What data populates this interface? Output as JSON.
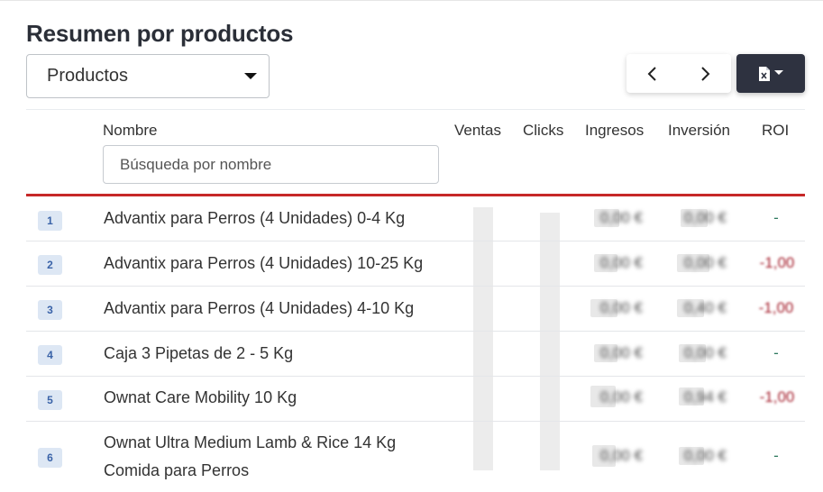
{
  "header": {
    "title": "Resumen por productos",
    "selector_value": "Productos"
  },
  "table": {
    "columns": {
      "name": "Nombre",
      "sales": "Ventas",
      "clicks": "Clicks",
      "revenue": "Ingresos",
      "investment": "Inversión",
      "roi": "ROI"
    },
    "search_placeholder": "Búsqueda por nombre",
    "rows": [
      {
        "index": "1",
        "name": "Advantix para Perros (4 Unidades) 0-4 Kg",
        "revenue": "0,00 €",
        "investment": "0,00 €",
        "roi": "-"
      },
      {
        "index": "2",
        "name": "Advantix para Perros (4 Unidades) 10-25 Kg",
        "revenue": "0,00 €",
        "investment": "0,00 €",
        "roi": "-1,00"
      },
      {
        "index": "3",
        "name": "Advantix para Perros (4 Unidades) 4-10 Kg",
        "revenue": "0,00 €",
        "investment": "0,40 €",
        "roi": "-1,00"
      },
      {
        "index": "4",
        "name": "Caja 3 Pipetas de 2 - 5 Kg",
        "revenue": "0,00 €",
        "investment": "0,00 €",
        "roi": "-"
      },
      {
        "index": "5",
        "name": "Ownat Care Mobility 10 Kg",
        "revenue": "0,00 €",
        "investment": "0,94 €",
        "roi": "-1,00"
      },
      {
        "index": "6",
        "name_line1": "Ownat Ultra Medium Lamb & Rice 14 Kg",
        "name_line2": "Comida para Perros",
        "revenue": "0,00 €",
        "investment": "0,00 €",
        "roi": "-"
      }
    ]
  },
  "colors": {
    "accent_red": "#c62828",
    "export_button": "#2e3240",
    "roi_negative": "#a31c2a",
    "roi_neutral": "#2f7a5f",
    "badge_bg": "#dde7f4"
  },
  "icons": {
    "prev": "chevron-left-icon",
    "next": "chevron-right-icon",
    "export": "excel-file-icon"
  }
}
